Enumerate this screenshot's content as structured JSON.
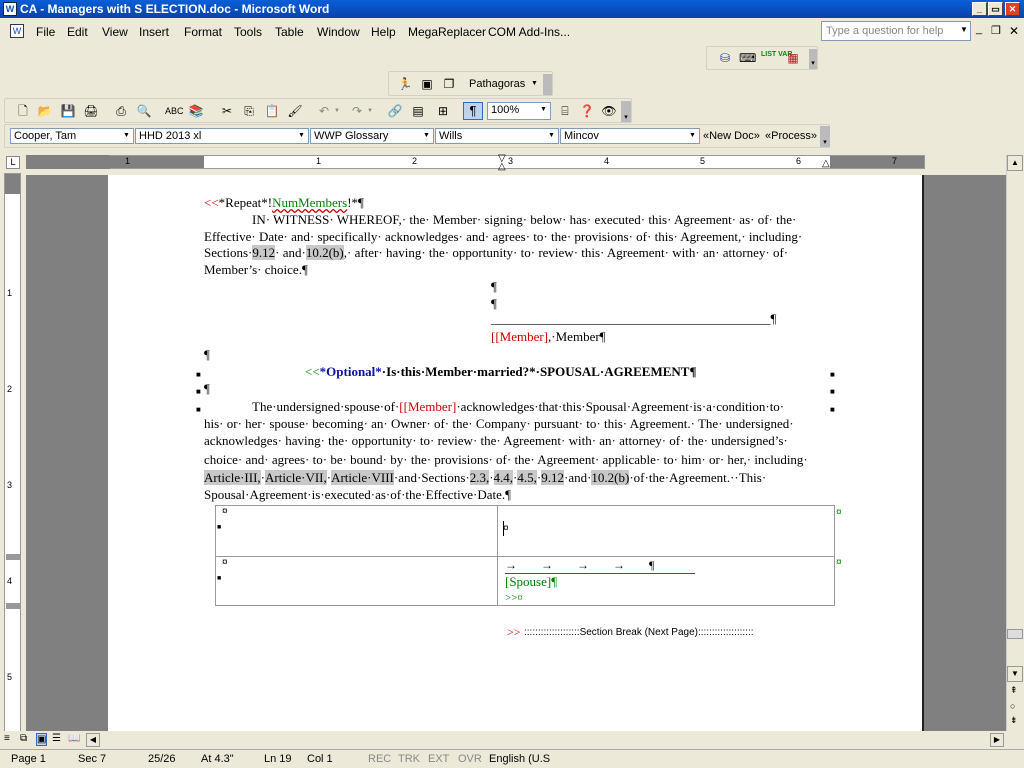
{
  "window": {
    "title": "CA - Managers with S ELECTION.doc - Microsoft Word",
    "app_icon": "word-icon"
  },
  "menu": {
    "items": [
      "File",
      "Edit",
      "View",
      "Insert",
      "Format",
      "Tools",
      "Table",
      "Window",
      "Help",
      "MegaReplacer",
      "COM Add-Ins..."
    ],
    "ask_placeholder": "Type a question for help"
  },
  "toolbar": {
    "pathagoras": "Pathagoras",
    "zoom": "100%",
    "combos": [
      "Cooper, Tam",
      "HHD 2013  xl",
      "WWP Glossary",
      "Wills",
      "Mincov"
    ],
    "new_doc": "«New Doc»",
    "process": "«Process»",
    "list_var_label": "LIST VAR"
  },
  "ruler": {
    "numbers": [
      "1",
      "1",
      "2",
      "3",
      "4",
      "5",
      "6",
      "7"
    ],
    "vnumbers": [
      "1",
      "2",
      "3",
      "4",
      "5"
    ]
  },
  "document": {
    "repeat_open": "<<",
    "repeat_text": "*Repeat*!",
    "num_members": "NumMembers",
    "repeat_close": "!*¶",
    "witness_1": "IN· WITNESS· WHEREOF,· the· Member· signing· below· has· executed· this· Agreement· as· of· the·",
    "witness_2a": "Effective· Date· and· specifically· acknowledges· and· agrees· to· the· provisions· of· this· Agreement,· including·",
    "witness_3a": "Sections·",
    "sec_912": "9.12",
    "witness_3b": "· and·",
    "sec_102b": "10.2(b)",
    "witness_3c": ",· after· having· the· opportunity· to· review· this· Agreement· with· an· attorney· of·",
    "witness_4": "Member’s· choice.¶",
    "pilcrow": "¶",
    "sig_line": "___________________________________________¶",
    "member_tag": "[Member]",
    "member_label": ",·Member¶",
    "opt_open": "<<",
    "opt_text": "*Optional*",
    "opt_question": "·Is·this·Member·married?*·SPOUSAL·AGREEMENT¶",
    "spouse_1a": "The·undersigned·spouse·of·",
    "spouse_1b": "·acknowledges·that·this·Spousal·Agreement·is·a·condition·to·",
    "spouse_2": "his· or· her· spouse· becoming· an· Owner· of· the· Company· pursuant· to· this· Agreement.· The· undersigned·",
    "spouse_3": "acknowledges· having· the· opportunity· to· review· the· Agreement· with· an· attorney· of· the· undersigned’s·",
    "spouse_4": "choice· and· agrees· to· be· bound· by· the· provisions· of· the· Agreement· applicable· to· him· or· her,· including·",
    "art3": "Article·III,",
    "art7": "Article·VII,",
    "art8": "Article·VIII",
    "spouse_5a": "·and·Sections·",
    "s23": "2.3,",
    "s44": "4.4,",
    "s45": "4.5,",
    "s912": "9.12",
    "spouse_5b": "·and·",
    "s102b": "10.2(b)",
    "spouse_5c": "·of·the·Agreement.··This·",
    "spouse_6": "Spousal·Agreement·is·executed·as·of·the·Effective·Date.¶",
    "cell_mark": "¤",
    "tab_arrows": "→        →        →        →        ¶",
    "spouse_tag": "[Spouse]¶",
    "close_tag": ">>¤",
    "sb_marker": ">>",
    "section_break": "::::::::::::::::::::Section Break (Next Page)::::::::::::::::::::"
  },
  "status": {
    "page": "Page 1",
    "sec": "Sec 7",
    "count": "25/26",
    "at": "At 4.3\"",
    "ln": "Ln 19",
    "col": "Col 1",
    "rec": "REC",
    "trk": "TRK",
    "ext": "EXT",
    "ovr": "OVR",
    "lang": "English (U.S"
  }
}
